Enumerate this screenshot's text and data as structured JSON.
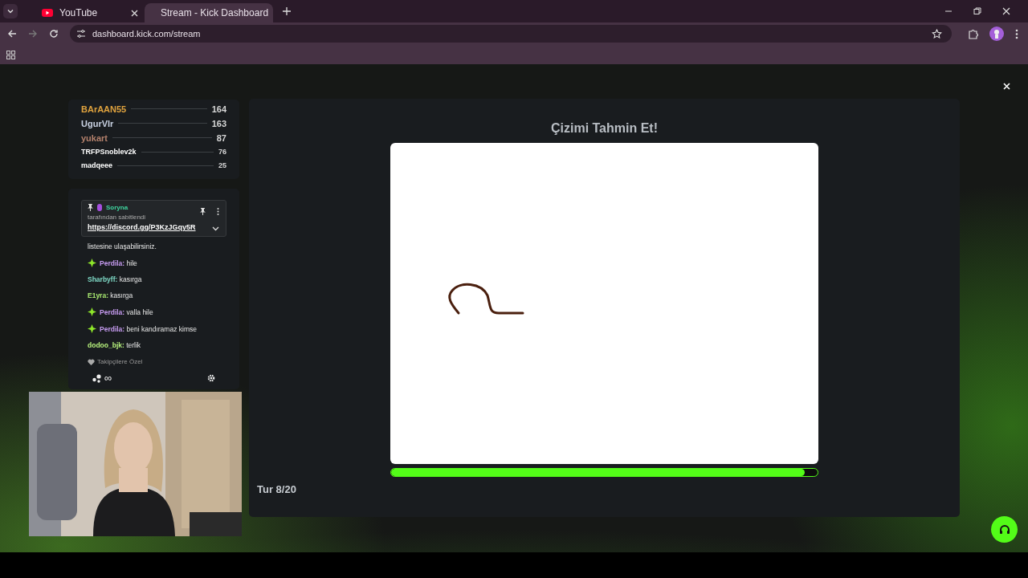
{
  "browser": {
    "tabs": [
      {
        "title": "YouTube",
        "selected": false
      },
      {
        "title": "Stream - Kick Dashboard",
        "selected": true
      }
    ],
    "url": "dashboard.kick.com/stream"
  },
  "leaderboard": [
    {
      "name": "BArAAN55",
      "score": "164",
      "color": "#e0a33e"
    },
    {
      "name": "UgurVlr",
      "score": "163",
      "color": "#c9d2e3"
    },
    {
      "name": "yukart",
      "score": "87",
      "color": "#b3806c"
    },
    {
      "name": "TRFPSnoblev2k",
      "score": "76",
      "color": "#ffffff"
    },
    {
      "name": "madqeee",
      "score": "25",
      "color": "#ffffff"
    }
  ],
  "pinned": {
    "author": "Soryna",
    "note": "tarafından sabitlendi",
    "link": "https://discord.gg/P3KzJGqy5R"
  },
  "chat": [
    {
      "kind": "text",
      "text": "listesine ulaşabilirsiniz."
    },
    {
      "kind": "message",
      "badge": true,
      "user": "Perdila:",
      "color": "#c79cf2",
      "text": "hile"
    },
    {
      "kind": "message",
      "badge": false,
      "user": "Sharbyff:",
      "color": "#80dcc8",
      "text": "kasırga"
    },
    {
      "kind": "message",
      "badge": false,
      "user": "E1yra:",
      "color": "#a8e870",
      "text": "kasırga"
    },
    {
      "kind": "message",
      "badge": true,
      "user": "Perdila:",
      "color": "#c79cf2",
      "text": "valla hile"
    },
    {
      "kind": "message",
      "badge": true,
      "user": "Perdila:",
      "color": "#c79cf2",
      "text": "beni kandıramaz kimse"
    },
    {
      "kind": "message",
      "badge": false,
      "user": "dodoo_bjk:",
      "color": "#b6f07c",
      "text": "terlik"
    }
  ],
  "chat_mode": "Takipçilere Özel",
  "chat_footer": "∞",
  "game": {
    "title": "Çizimi Tahmin Et!",
    "timer": {
      "level": 0.97
    },
    "round": "Tur 8/20"
  }
}
